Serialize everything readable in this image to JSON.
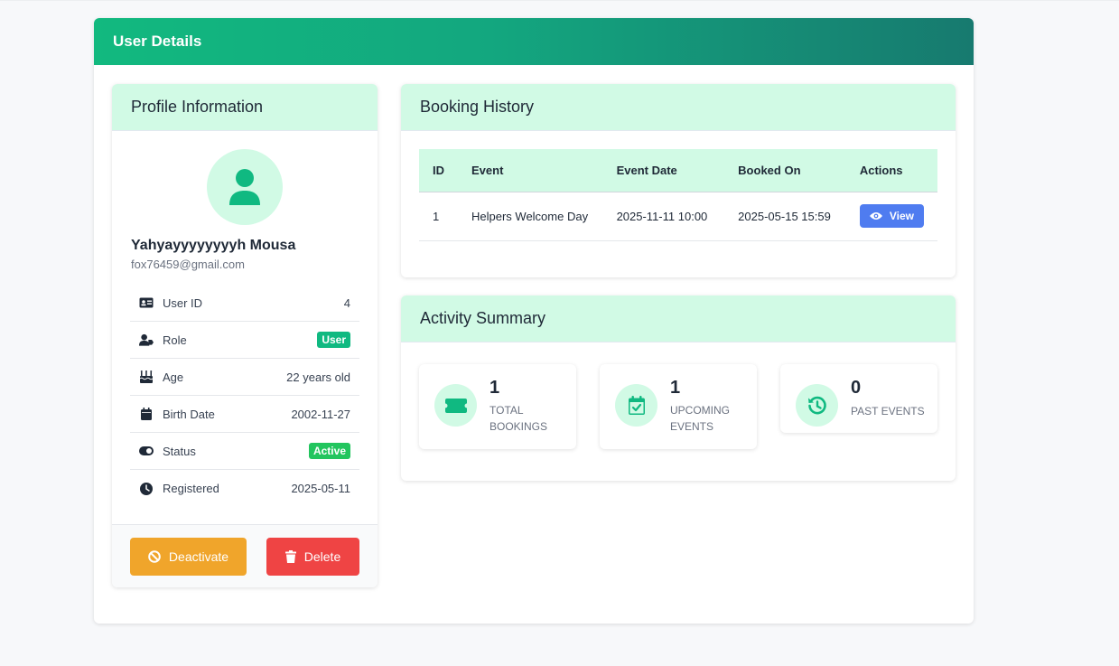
{
  "header": {
    "title": "User Details"
  },
  "profile": {
    "title": "Profile Information",
    "name": "Yahyayyyyyyyyh Mousa",
    "email": "fox76459@gmail.com",
    "rows": [
      {
        "label": "User ID",
        "value": "4",
        "icon": "id-card-icon"
      },
      {
        "label": "Role",
        "value": "User",
        "icon": "user-tag-icon"
      },
      {
        "label": "Age",
        "value": "22 years old",
        "icon": "birthday-cake-icon"
      },
      {
        "label": "Birth Date",
        "value": "2002-11-27",
        "icon": "calendar-icon"
      },
      {
        "label": "Status",
        "value": "Active",
        "icon": "toggle-icon"
      },
      {
        "label": "Registered",
        "value": "2025-05-11",
        "icon": "clock-icon"
      }
    ],
    "deactivate_label": "Deactivate",
    "delete_label": "Delete"
  },
  "booking": {
    "title": "Booking History",
    "columns": [
      "ID",
      "Event",
      "Event Date",
      "Booked On",
      "Actions"
    ],
    "rows": [
      {
        "id": "1",
        "event": "Helpers Welcome Day",
        "event_date": "2025-11-11 10:00",
        "booked_on": "2025-05-15 15:59",
        "action": "View"
      }
    ]
  },
  "activity": {
    "title": "Activity Summary",
    "stats": [
      {
        "value": "1",
        "label": "TOTAL BOOKINGS",
        "icon": "ticket-icon"
      },
      {
        "value": "1",
        "label": "UPCOMING EVENTS",
        "icon": "calendar-check-icon"
      },
      {
        "value": "0",
        "label": "PAST EVENTS",
        "icon": "history-icon"
      }
    ]
  },
  "colors": {
    "accent": "#10b981",
    "header_gradient_start": "#12b97f",
    "header_gradient_end": "#177a6f",
    "panel_header_bg": "#d1fae5",
    "deactivate": "#f0a52b",
    "delete": "#ef4444",
    "view": "#4f7cf0"
  }
}
